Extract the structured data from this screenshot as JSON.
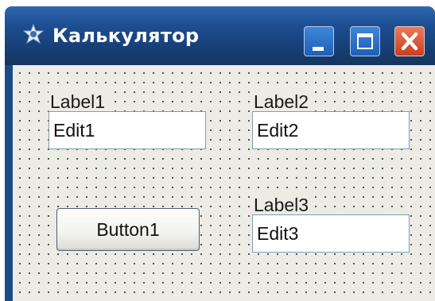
{
  "window": {
    "title": "Калькулятор",
    "icon": "app-icon",
    "controls": [
      "minimize-icon",
      "maximize-icon",
      "close-icon"
    ]
  },
  "form": {
    "label1": "Label1",
    "edit1": "Edit1",
    "label2": "Label2",
    "edit2": "Edit2",
    "label3": "Label3",
    "edit3": "Edit3",
    "button1": "Button1"
  },
  "colors": {
    "titlebar": "#1d4f93",
    "close_button": "#d04a28",
    "form_background": "#ecebe4"
  }
}
